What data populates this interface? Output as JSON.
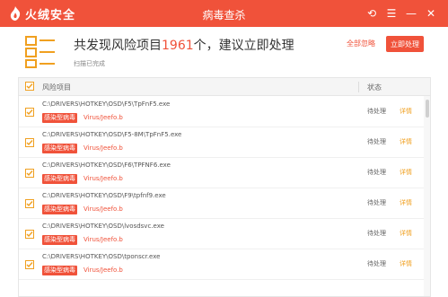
{
  "app": {
    "logo_text": "火绒安全",
    "title": "病毒查杀"
  },
  "window_controls": {
    "back": "⟲",
    "menu": "☰",
    "minimize": "—",
    "close": "✕"
  },
  "summary": {
    "title_prefix": "共发现风险项目",
    "count": "1961",
    "title_suffix": "个，建议立即处理",
    "subtitle": "扫描已完成",
    "ignore_all_label": "全部忽略",
    "fix_now_label": "立即处理"
  },
  "table": {
    "header_name": "风险项目",
    "header_status": "状态",
    "rows": [
      {
        "path": "C:\\DRIVERS\\HOTKEY\\OSD\\F5\\TpFnF5.exe",
        "tag": "感染型病毒",
        "virus": "Virus/Jeefo.b",
        "status": "待处理",
        "detail": "详情"
      },
      {
        "path": "C:\\DRIVERS\\HOTKEY\\OSD\\F5-8M\\TpFnF5.exe",
        "tag": "感染型病毒",
        "virus": "Virus/Jeefo.b",
        "status": "待处理",
        "detail": "详情"
      },
      {
        "path": "C:\\DRIVERS\\HOTKEY\\OSD\\F6\\TPFNF6.exe",
        "tag": "感染型病毒",
        "virus": "Virus/Jeefo.b",
        "status": "待处理",
        "detail": "详情"
      },
      {
        "path": "C:\\DRIVERS\\HOTKEY\\OSD\\F9\\tpfnf9.exe",
        "tag": "感染型病毒",
        "virus": "Virus/Jeefo.b",
        "status": "待处理",
        "detail": "详情"
      },
      {
        "path": "C:\\DRIVERS\\HOTKEY\\OSD\\lvosdsvc.exe",
        "tag": "感染型病毒",
        "virus": "Virus/Jeefo.b",
        "status": "待处理",
        "detail": "详情"
      },
      {
        "path": "C:\\DRIVERS\\HOTKEY\\OSD\\tponscr.exe",
        "tag": "感染型病毒",
        "virus": "Virus/Jeefo.b",
        "status": "待处理",
        "detail": "详情"
      }
    ]
  },
  "colors": {
    "brand": "#f0523a",
    "checkbox": "#f0a020"
  }
}
